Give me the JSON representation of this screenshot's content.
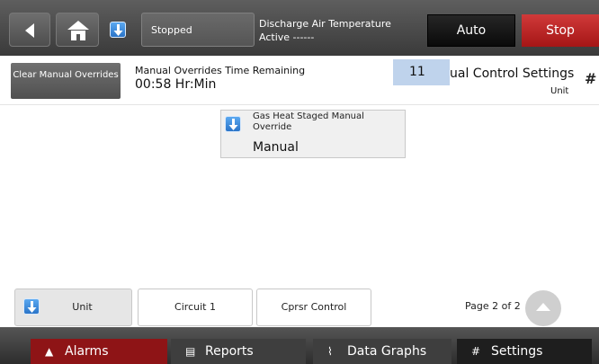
{
  "topbar": {
    "status": "Stopped",
    "discharge_title": "Discharge Air Temperature",
    "discharge_value": "Active ------",
    "auto_label": "Auto",
    "stop_label": "Stop"
  },
  "info": {
    "clear_label": "Clear Manual Overrides",
    "remaining_title": "Manual Overrides Time Remaining",
    "remaining_value": "00:58 Hr:Min",
    "badge": "11",
    "settings_title": "ual Control Settings",
    "settings_sub": "Unit"
  },
  "card": {
    "label": "Gas Heat Staged Manual Override",
    "value": "Manual"
  },
  "tabs": [
    {
      "label": "Unit"
    },
    {
      "label": "Circuit 1"
    },
    {
      "label": "Cprsr Control"
    }
  ],
  "pagination": {
    "label": "Page 2 of 2"
  },
  "bottomnav": [
    {
      "label": "Alarms",
      "icon": "bell-icon"
    },
    {
      "label": "Reports",
      "icon": "document-icon"
    },
    {
      "label": "Data Graphs",
      "icon": "chart-icon"
    },
    {
      "label": "Settings",
      "icon": "sliders-icon"
    }
  ],
  "colors": {
    "accent_blue": "#2a74c8",
    "stop_red": "#a51616",
    "alarms_red": "#8e1416",
    "badge_blue": "#bfd3ec"
  }
}
